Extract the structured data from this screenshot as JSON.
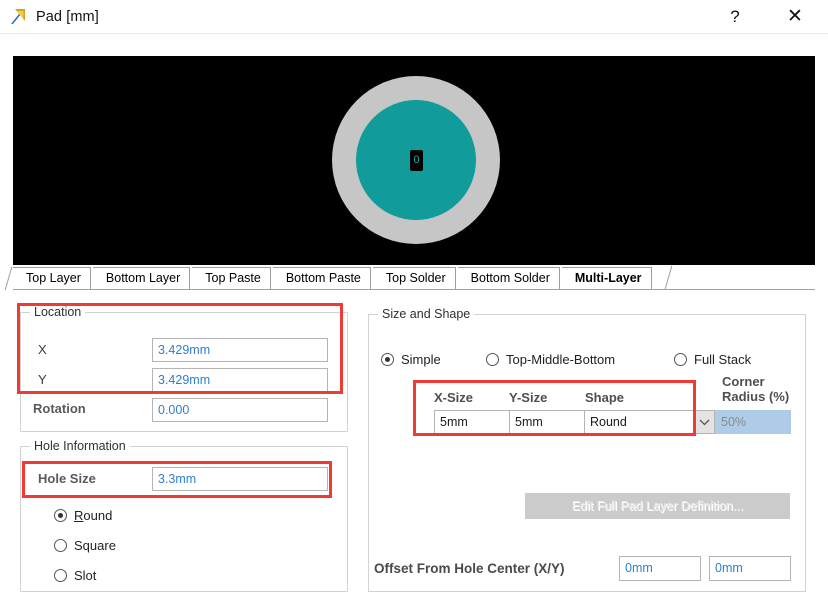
{
  "window": {
    "title": "Pad [mm]",
    "icon": "altium-pad-icon",
    "help_label": "?",
    "close_label": "✕"
  },
  "preview": {
    "label": "pad-preview",
    "pad_number": "0",
    "background_color": "#000000",
    "outer_ring_color": "#c6c6c6",
    "pad_color": "#119b9b",
    "hole_color": "#000000"
  },
  "tabs": [
    {
      "label": "Top Layer",
      "active": false
    },
    {
      "label": "Bottom Layer",
      "active": false
    },
    {
      "label": "Top Paste",
      "active": false
    },
    {
      "label": "Bottom Paste",
      "active": false
    },
    {
      "label": "Top Solder",
      "active": false
    },
    {
      "label": "Bottom Solder",
      "active": false
    },
    {
      "label": "Multi-Layer",
      "active": true
    }
  ],
  "location": {
    "legend": "Location",
    "x_label": "X",
    "x_value": "3.429mm",
    "y_label": "Y",
    "y_value": "3.429mm",
    "rotation_label": "Rotation",
    "rotation_value": "0.000"
  },
  "hole_information": {
    "legend": "Hole Information",
    "hole_size_label": "Hole Size",
    "hole_size_value": "3.3mm",
    "shapes": [
      {
        "label": "Round",
        "mnemonic": "R",
        "rest": "ound",
        "selected": true
      },
      {
        "label": "Square",
        "mnemonic": "",
        "rest": "Square",
        "selected": false
      },
      {
        "label": "Slot",
        "mnemonic": "",
        "rest": "Slot",
        "selected": false
      }
    ]
  },
  "size_and_shape": {
    "legend": "Size and Shape",
    "modes": [
      {
        "label": "Simple",
        "selected": true
      },
      {
        "label": "Top-Middle-Bottom",
        "selected": false
      },
      {
        "label": "Full Stack",
        "selected": false
      }
    ],
    "table": {
      "headers": {
        "x_size": "X-Size",
        "y_size": "Y-Size",
        "shape": "Shape",
        "corner_radius_line1": "Corner",
        "corner_radius_line2": "Radius (%)"
      },
      "row": {
        "x_size": "5mm",
        "y_size": "5mm",
        "shape": "Round",
        "corner_radius": "50%"
      }
    },
    "edit_full_pad_button": "Edit Full Pad Layer Definition...",
    "offset_label": "Offset From Hole Center (X/Y)",
    "offset_x": "0mm",
    "offset_y": "0mm"
  },
  "annotations": {
    "highlight_color": "#ef3b33",
    "boxes": [
      "location-xy",
      "hole-size",
      "size-shape-table"
    ]
  }
}
